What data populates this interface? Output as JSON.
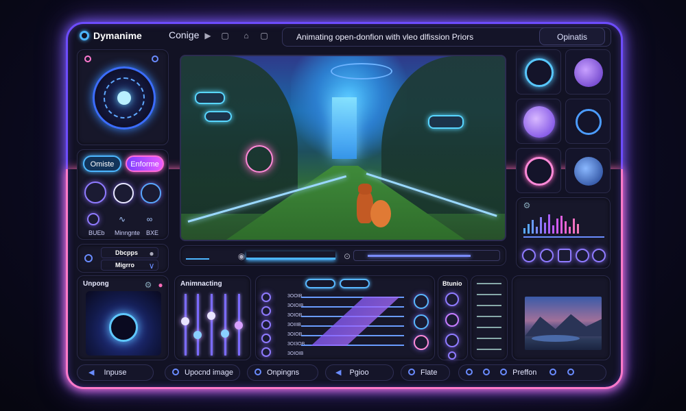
{
  "app": {
    "name": "Dymanime",
    "menu_item": "Conige",
    "title": "Animating open-donfion with vleo dlfission Priors",
    "options_label": "Opinatis"
  },
  "left_panel": {
    "pill_left": "Omiste",
    "pill_right": "Enforme",
    "small_labels": [
      "BUEb",
      "Minngnte",
      "BXE"
    ],
    "row1_label": "Dbcpps",
    "row2_label": "Migrro"
  },
  "bottom_panels": {
    "unpong_title": "Unpong",
    "animating_title": "Animnacting",
    "studio_title": "Btunio",
    "list_labels": [
      "3OOIB",
      "3OIOIB",
      "3OIOB",
      "3OIIIB",
      "3OIOB",
      "3OI3OB",
      "3OIOIB"
    ]
  },
  "bottom_bar": {
    "items": [
      {
        "label": "Inpuse",
        "icon": "play-back-icon"
      },
      {
        "label": "Upocnd image",
        "icon": "upload-icon"
      },
      {
        "label": "Onpingns",
        "icon": "settings-icon"
      },
      {
        "label": "Pgioo",
        "icon": "arrow-icon"
      },
      {
        "label": "Flate",
        "icon": "flag-icon"
      },
      {
        "label": "Preffon",
        "icon": "preferences-icon"
      }
    ]
  },
  "colors": {
    "accent_blue": "#4cb6ff",
    "accent_purple": "#8f7bff",
    "accent_pink": "#ff6cb8",
    "background": "#121224"
  }
}
